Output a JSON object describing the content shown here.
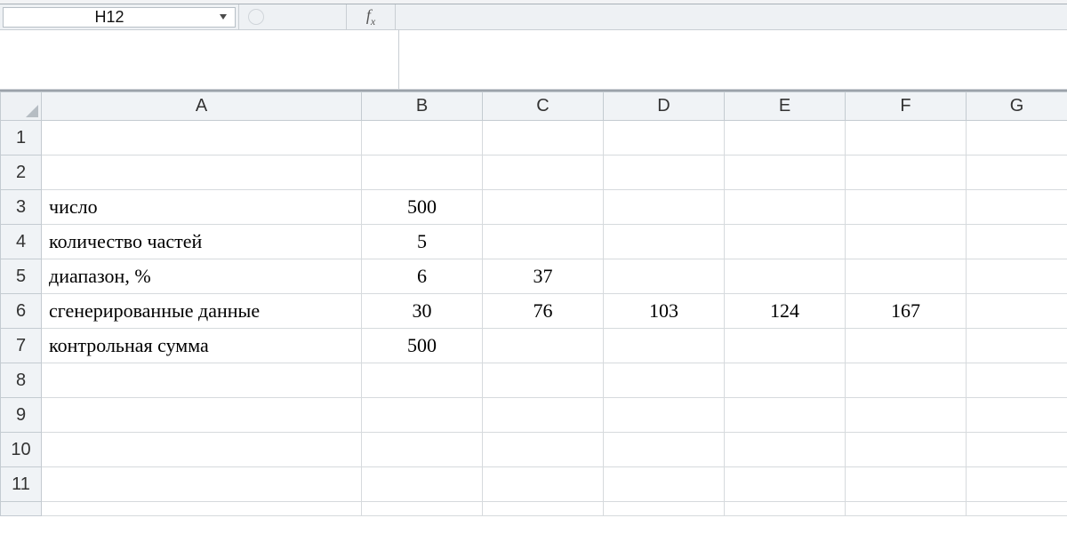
{
  "name_box": {
    "value": "H12"
  },
  "fx_label": "ƒx",
  "columns": [
    "A",
    "B",
    "C",
    "D",
    "E",
    "F",
    "G"
  ],
  "rows": [
    "1",
    "2",
    "3",
    "4",
    "5",
    "6",
    "7",
    "8",
    "9",
    "10",
    "11"
  ],
  "cells": {
    "A3": "число",
    "B3": "500",
    "A4": "количество частей",
    "B4": "5",
    "A5": "диапазон, %",
    "B5": "6",
    "C5": "37",
    "A6": "сгенерированные данные",
    "B6": "30",
    "C6": "76",
    "D6": "103",
    "E6": "124",
    "F6": "167",
    "A7": "контрольная сумма",
    "B7": "500"
  }
}
